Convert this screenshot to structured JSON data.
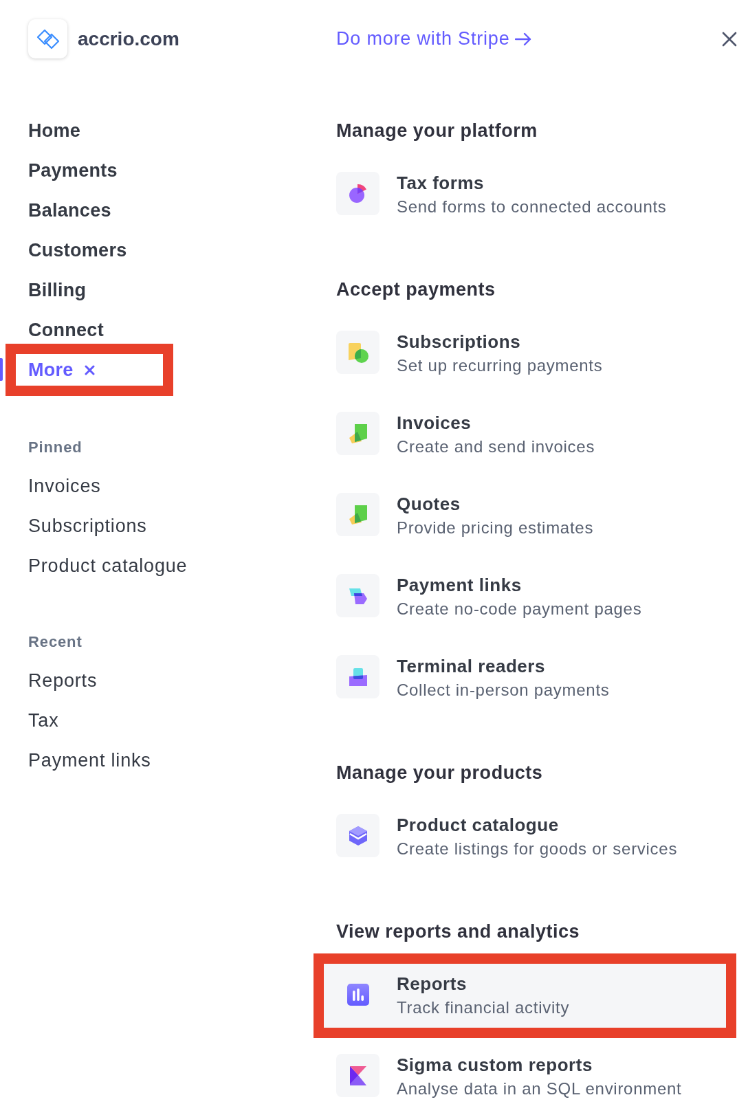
{
  "header": {
    "account_name": "accrio.com",
    "promo_link": "Do more with Stripe"
  },
  "nav": {
    "items": [
      {
        "label": "Home",
        "kind": "link",
        "selected": false,
        "highlighted": false
      },
      {
        "label": "Payments",
        "kind": "link",
        "selected": false,
        "highlighted": false
      },
      {
        "label": "Balances",
        "kind": "link",
        "selected": false,
        "highlighted": false
      },
      {
        "label": "Customers",
        "kind": "link",
        "selected": false,
        "highlighted": false
      },
      {
        "label": "Billing",
        "kind": "link",
        "selected": false,
        "highlighted": false
      },
      {
        "label": "Connect",
        "kind": "link",
        "selected": false,
        "highlighted": false
      },
      {
        "label": "More",
        "kind": "toggle",
        "selected": true,
        "highlighted": true
      }
    ]
  },
  "pinned": {
    "title": "Pinned",
    "items": [
      {
        "label": "Invoices"
      },
      {
        "label": "Subscriptions"
      },
      {
        "label": "Product catalogue"
      }
    ]
  },
  "recent": {
    "title": "Recent",
    "items": [
      {
        "label": "Reports"
      },
      {
        "label": "Tax"
      },
      {
        "label": "Payment links"
      }
    ]
  },
  "sections": [
    {
      "title": "Manage your platform",
      "items": [
        {
          "kind": "tax",
          "title": "Tax forms",
          "subtitle": "Send forms to connected accounts",
          "hovered": false,
          "highlighted": false
        }
      ]
    },
    {
      "title": "Accept payments",
      "items": [
        {
          "kind": "subscriptions",
          "title": "Subscriptions",
          "subtitle": "Set up recurring payments",
          "hovered": false,
          "highlighted": false
        },
        {
          "kind": "invoices",
          "title": "Invoices",
          "subtitle": "Create and send invoices",
          "hovered": false,
          "highlighted": false
        },
        {
          "kind": "invoices",
          "title": "Quotes",
          "subtitle": "Provide pricing estimates",
          "hovered": false,
          "highlighted": false
        },
        {
          "kind": "links",
          "title": "Payment links",
          "subtitle": "Create no-code payment pages",
          "hovered": false,
          "highlighted": false
        },
        {
          "kind": "terminal",
          "title": "Terminal readers",
          "subtitle": "Collect in-person payments",
          "hovered": false,
          "highlighted": false
        }
      ]
    },
    {
      "title": "Manage your products",
      "items": [
        {
          "kind": "catalogue",
          "title": "Product catalogue",
          "subtitle": "Create listings for goods or services",
          "hovered": false,
          "highlighted": false
        }
      ]
    },
    {
      "title": "View reports and analytics",
      "items": [
        {
          "kind": "reports",
          "title": "Reports",
          "subtitle": "Track financial activity",
          "hovered": true,
          "highlighted": true
        },
        {
          "kind": "sigma",
          "title": "Sigma custom reports",
          "subtitle": "Analyse data in an SQL environment",
          "hovered": false,
          "highlighted": false
        }
      ]
    }
  ]
}
